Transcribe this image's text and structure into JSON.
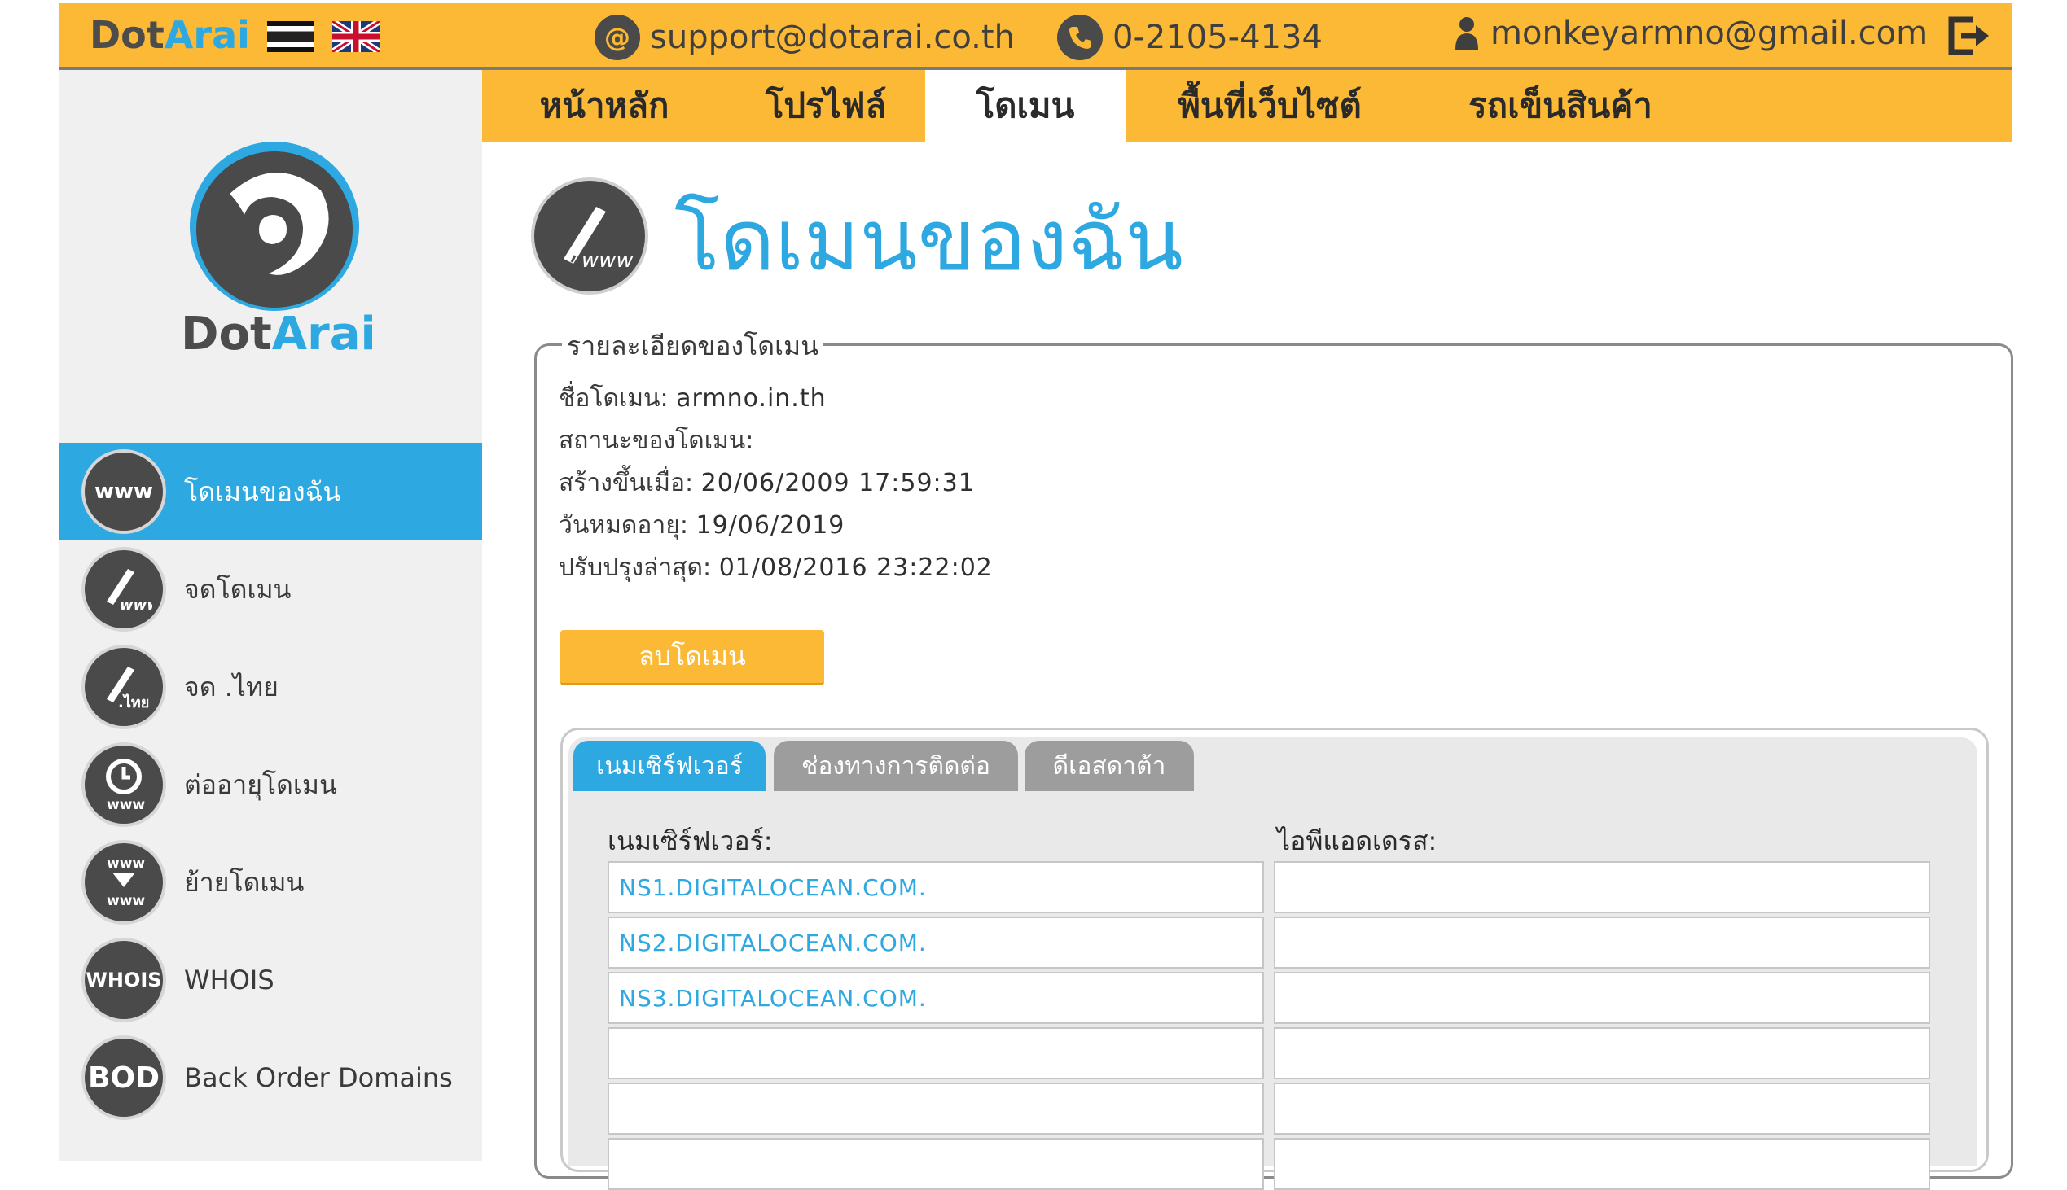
{
  "brand": {
    "name_dark": "Dot",
    "name_blue": "Arai"
  },
  "top_bar": {
    "email_support": "support@dotarai.co.th",
    "phone": "0-2105-4134",
    "user_email": "monkeyarmno@gmail.com"
  },
  "nav": {
    "items": [
      {
        "label": "หน้าหลัก"
      },
      {
        "label": "โปรไฟล์"
      },
      {
        "label": "โดเมน"
      },
      {
        "label": "พื้นที่เว็บไซต์"
      },
      {
        "label": "รถเข็นสินค้า"
      }
    ],
    "active": "โดเมน"
  },
  "sidebar": {
    "items": [
      {
        "label": "โดเมนของฉัน",
        "icon": "www",
        "active": true
      },
      {
        "label": "จดโดเมน",
        "icon": "pen-www"
      },
      {
        "label": "จด .ไทย",
        "icon": "pen-thai"
      },
      {
        "label": "ต่ออายุโดเมน",
        "icon": "clock-www"
      },
      {
        "label": "ย้ายโดเมน",
        "icon": "transfer-www"
      },
      {
        "label": "WHOIS",
        "icon": "whois"
      },
      {
        "label": "Back Order Domains",
        "icon": "bod"
      }
    ],
    "icon_text": {
      "www": "www",
      "thai": ".ไทย",
      "whois": "WHOIS",
      "bod": "BOD"
    }
  },
  "page": {
    "title": "โดเมนของฉัน"
  },
  "details": {
    "legend": "รายละเอียดของโดเมน",
    "domain_name_label": "ชื่อโดเมน:",
    "domain_name": "armno.in.th",
    "status_label": "สถานะของโดเมน:",
    "status": "",
    "created_label": "สร้างขึ้นเมื่อ:",
    "created": "20/06/2009 17:59:31",
    "expires_label": "วันหมดอายุ:",
    "expires": "19/06/2019",
    "updated_label": "ปรับปรุงล่าสุด:",
    "updated": "01/08/2016 23:22:02",
    "delete_button": "ลบโดเมน"
  },
  "tabs": {
    "items": [
      {
        "label": "เนมเซิร์ฟเวอร์"
      },
      {
        "label": "ช่องทางการติดต่อ"
      },
      {
        "label": "ดีเอสดาต้า"
      }
    ],
    "active": "เนมเซิร์ฟเวอร์"
  },
  "nameservers": {
    "col_ns": "เนมเซิร์ฟเวอร์:",
    "col_ip": "ไอพีแอดเดรส:",
    "rows": [
      {
        "ns": "NS1.DIGITALOCEAN.COM.",
        "ip": ""
      },
      {
        "ns": "NS2.DIGITALOCEAN.COM.",
        "ip": ""
      },
      {
        "ns": "NS3.DIGITALOCEAN.COM.",
        "ip": ""
      },
      {
        "ns": "",
        "ip": ""
      },
      {
        "ns": "",
        "ip": ""
      },
      {
        "ns": "",
        "ip": ""
      }
    ]
  },
  "colors": {
    "accent_orange": "#fcb935",
    "accent_blue": "#2ea8e0",
    "dark_gray": "#4a4a4a"
  }
}
